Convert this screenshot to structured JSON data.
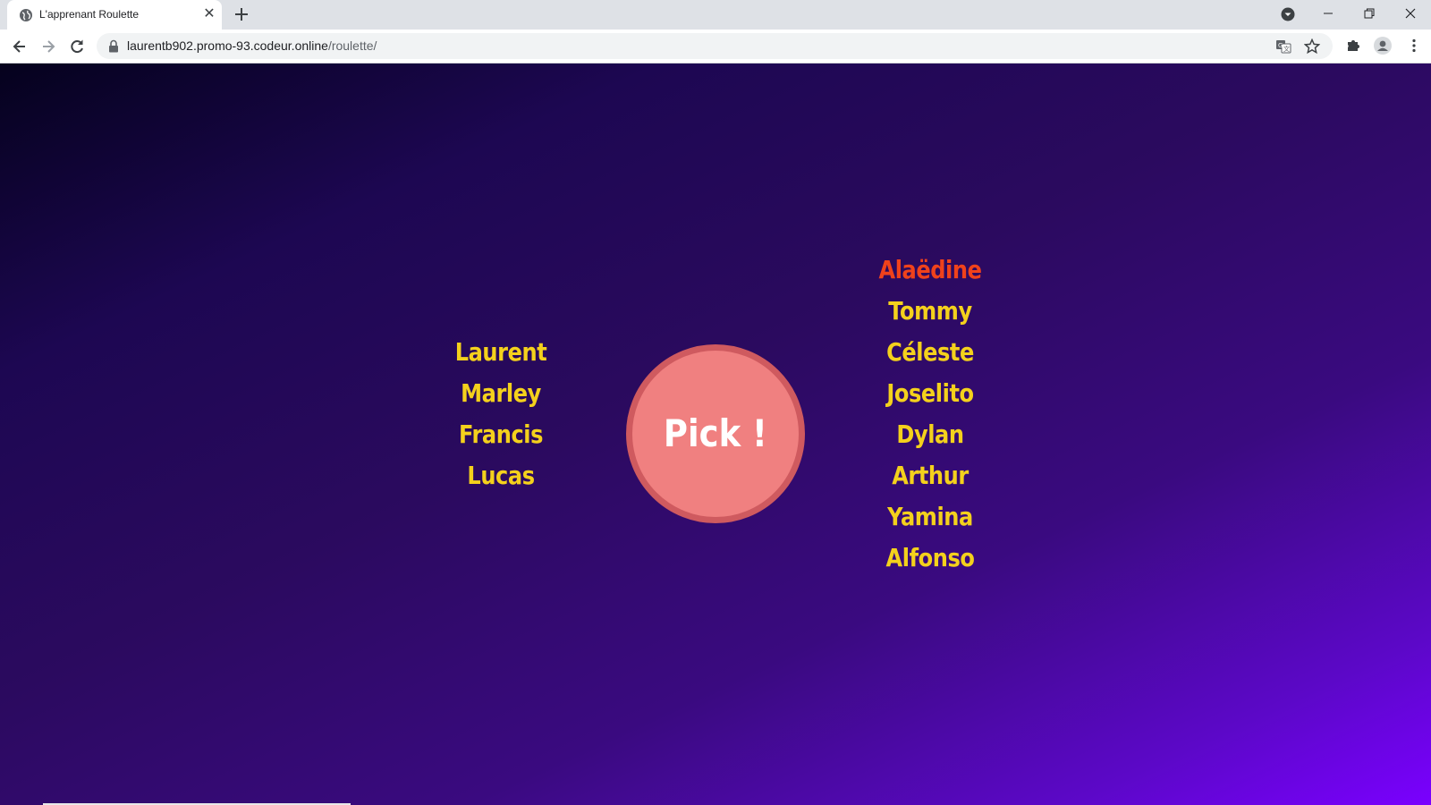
{
  "browser": {
    "tab_title": "L'apprenant Roulette",
    "url_host": "laurentb902.promo-93.codeur.online",
    "url_path": "/roulette/"
  },
  "roulette": {
    "left_names": [
      "Laurent",
      "Marley",
      "Francis",
      "Lucas"
    ],
    "right_names": [
      "Alaëdine",
      "Tommy",
      "Céleste",
      "Joselito",
      "Dylan",
      "Arthur",
      "Yamina",
      "Alfonso"
    ],
    "picked_name": "Alaëdine",
    "pick_label": "Pick !"
  },
  "colors": {
    "name": "#f4d11c",
    "picked": "#f0421b",
    "button_fill": "#f08080",
    "button_border": "#cf5a5f",
    "background_start": "#05021d",
    "background_end": "#7a00ff"
  }
}
